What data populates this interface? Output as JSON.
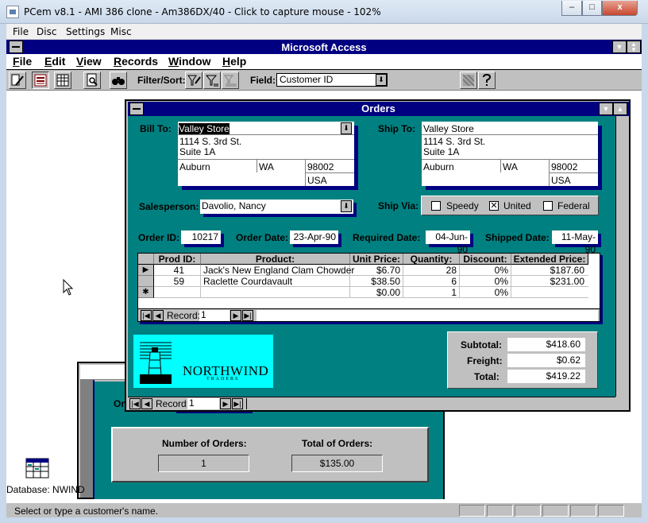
{
  "host": {
    "title": "PCem v8.1 - AMI 386 clone - Am386DX/40 - Click to capture mouse - 102%",
    "menu": [
      "File",
      "Disc",
      "Settings",
      "Misc"
    ],
    "controls": {
      "minimize": "–",
      "maximize": "□",
      "close": "x"
    }
  },
  "access": {
    "title": "Microsoft Access",
    "menu": [
      {
        "u": "F",
        "rest": "ile"
      },
      {
        "u": "E",
        "rest": "dit"
      },
      {
        "u": "V",
        "rest": "iew"
      },
      {
        "u": "R",
        "rest": "ecords"
      },
      {
        "u": "W",
        "rest": "indow"
      },
      {
        "u": "H",
        "rest": "elp"
      }
    ],
    "toolbar": {
      "filter_label": "Filter/Sort:",
      "field_label": "Field:",
      "field_value": "Customer ID"
    },
    "status_text": "Select or type a customer's name.",
    "database_label": "Database: NWIND"
  },
  "background_form": {
    "partial_label": "Or",
    "record_label": "Record:",
    "record_value": "1",
    "number_of_orders_label": "Number of Orders:",
    "number_of_orders_value": "1",
    "total_of_orders_label": "Total of Orders:",
    "total_of_orders_value": "$135.00"
  },
  "orders": {
    "title": "Orders",
    "bill_to_label": "Bill To:",
    "ship_to_label": "Ship To:",
    "bill_to": {
      "name": "Valley Store",
      "address": "1114 S. 3rd St.",
      "suite": "Suite 1A",
      "city": "Auburn",
      "state": "WA",
      "zip": "98002",
      "country": "USA"
    },
    "ship_to": {
      "name": "Valley Store",
      "address": "1114 S. 3rd St.",
      "suite": "Suite 1A",
      "city": "Auburn",
      "state": "WA",
      "zip": "98002",
      "country": "USA"
    },
    "salesperson_label": "Salesperson:",
    "salesperson_value": "Davolio, Nancy",
    "ship_via_label": "Ship Via:",
    "ship_via_options": [
      {
        "label": "Speedy",
        "mark": ""
      },
      {
        "label": "United",
        "mark": "✕"
      },
      {
        "label": "Federal",
        "mark": ""
      }
    ],
    "order_id_label": "Order ID:",
    "order_id_value": "10217",
    "order_date_label": "Order Date:",
    "order_date_value": "23-Apr-90",
    "required_date_label": "Required Date:",
    "required_date_value": "04-Jun-90",
    "shipped_date_label": "Shipped Date:",
    "shipped_date_value": "11-May-90",
    "grid": {
      "headers": [
        "Prod ID:",
        "Product:",
        "Unit Price:",
        "Quantity:",
        "Discount:",
        "Extended Price:"
      ],
      "rows": [
        {
          "selector": "▶",
          "prod_id": "41",
          "product": "Jack's New England Clam Chowder",
          "unit_price": "$6.70",
          "quantity": "28",
          "discount": "0%",
          "extended": "$187.60"
        },
        {
          "selector": "",
          "prod_id": "59",
          "product": "Raclette Courdavault",
          "unit_price": "$38.50",
          "quantity": "6",
          "discount": "0%",
          "extended": "$231.00"
        },
        {
          "selector": "✱",
          "prod_id": "",
          "product": "",
          "unit_price": "$0.00",
          "quantity": "1",
          "discount": "0%",
          "extended": ""
        }
      ],
      "record_label": "Record:",
      "record_value": "1"
    },
    "logo": {
      "name": "NORTHWIND",
      "sub": "TRADERS"
    },
    "subtotal_label": "Subtotal:",
    "subtotal_value": "$418.60",
    "freight_label": "Freight:",
    "freight_value": "$0.62",
    "total_label": "Total:",
    "total_value": "$419.22",
    "record_label": "Record:",
    "record_value": "1"
  }
}
